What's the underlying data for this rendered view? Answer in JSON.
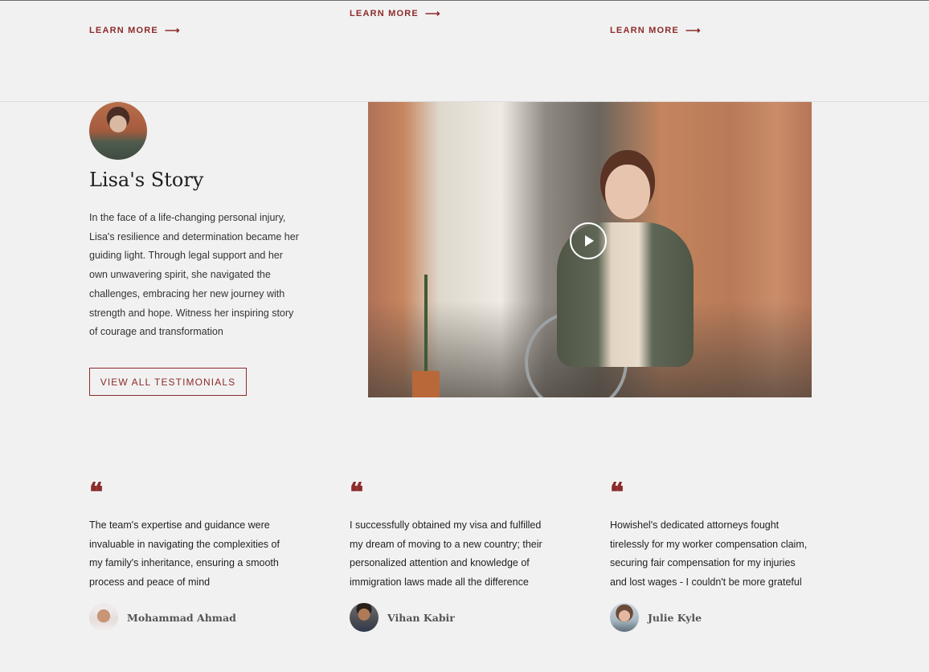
{
  "learn_more": [
    {
      "label": "LEARN MORE"
    },
    {
      "label": "LEARN MORE"
    },
    {
      "label": "LEARN MORE"
    }
  ],
  "story": {
    "title": "Lisa's Story",
    "text": "In the face of a life-changing personal injury, Lisa's resilience and determination became her guiding light. Through legal support and her own unwavering spirit, she navigated the challenges, embracing her new journey with strength and hope. Witness her inspiring story of courage and transformation",
    "button_label": "VIEW ALL TESTIMONIALS"
  },
  "video": {
    "play_icon": "play-icon"
  },
  "testimonials": [
    {
      "quote_icon": "quote-icon",
      "text": "The team's expertise and guidance were invaluable in navigating the complexities of my family's inheritance, ensuring a smooth process and peace of mind",
      "author": "Mohammad Ahmad"
    },
    {
      "quote_icon": "quote-icon",
      "text": "I successfully obtained my visa and fulfilled my dream of moving to a new country; their personalized attention and knowledge of immigration laws made all the difference",
      "author": "Vihan Kabir"
    },
    {
      "quote_icon": "quote-icon",
      "text": "Howishel's dedicated attorneys fought tirelessly for my worker compensation claim, securing fair compensation for my injuries and lost wages - I couldn't be more grateful",
      "author": "Julie Kyle"
    }
  ],
  "colors": {
    "accent": "#8c2b2b",
    "background": "#f2f1f1"
  }
}
